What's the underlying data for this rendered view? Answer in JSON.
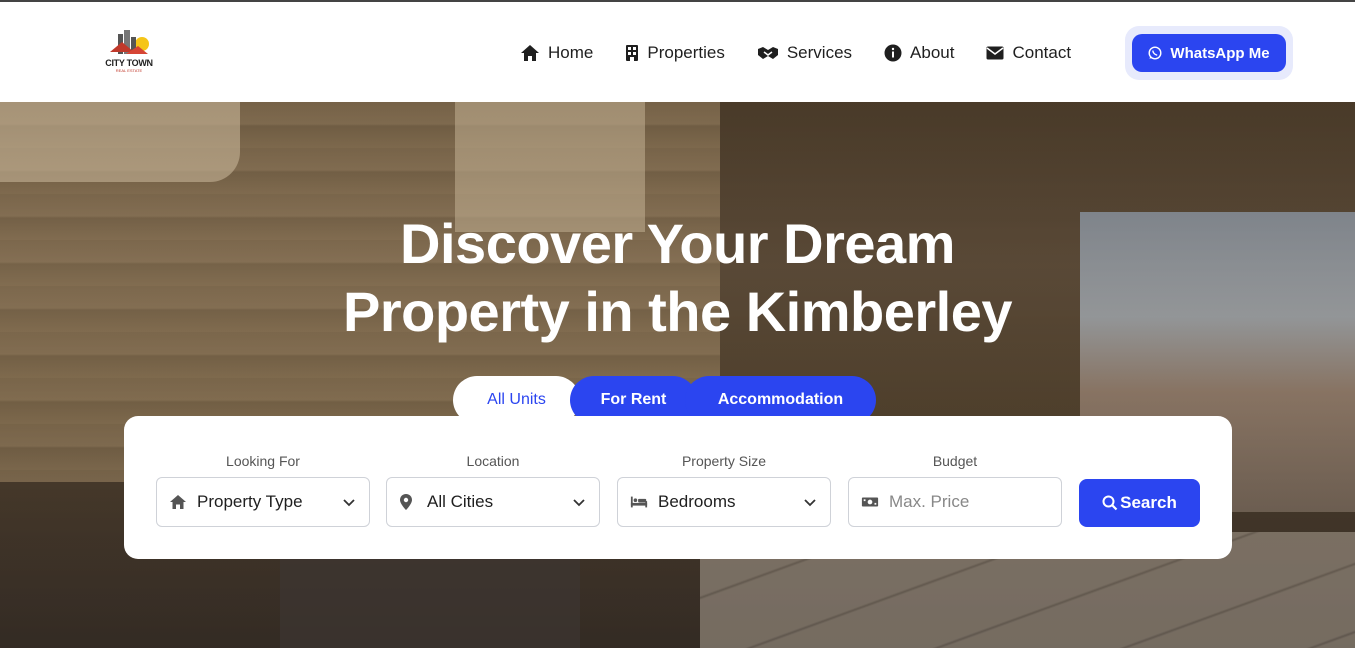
{
  "logo": {
    "name": "CITY TOWN",
    "tagline": "REAL ESTATE"
  },
  "nav": {
    "items": [
      {
        "label": "Home",
        "icon": "home-icon"
      },
      {
        "label": "Properties",
        "icon": "building-icon"
      },
      {
        "label": "Services",
        "icon": "handshake-icon"
      },
      {
        "label": "About",
        "icon": "info-icon"
      },
      {
        "label": "Contact",
        "icon": "envelope-icon"
      }
    ],
    "whatsapp_label": "WhatsApp Me"
  },
  "hero": {
    "title_line1": "Discover Your Dream",
    "title_line2": "Property in the Kimberley"
  },
  "tabs": [
    {
      "label": "All Units",
      "active": true
    },
    {
      "label": "For Rent",
      "active": false
    },
    {
      "label": "Accommodation",
      "active": false
    }
  ],
  "search": {
    "fields": [
      {
        "label": "Looking For",
        "value": "Property Type",
        "icon": "home-icon"
      },
      {
        "label": "Location",
        "value": "All Cities",
        "icon": "map-pin-icon"
      },
      {
        "label": "Property Size",
        "value": "Bedrooms",
        "icon": "bed-icon"
      },
      {
        "label": "Budget",
        "placeholder": "Max. Price",
        "icon": "money-icon"
      }
    ],
    "button_label": "Search"
  },
  "colors": {
    "accent": "#2b45f0",
    "accent_soft": "#e7eafc"
  }
}
